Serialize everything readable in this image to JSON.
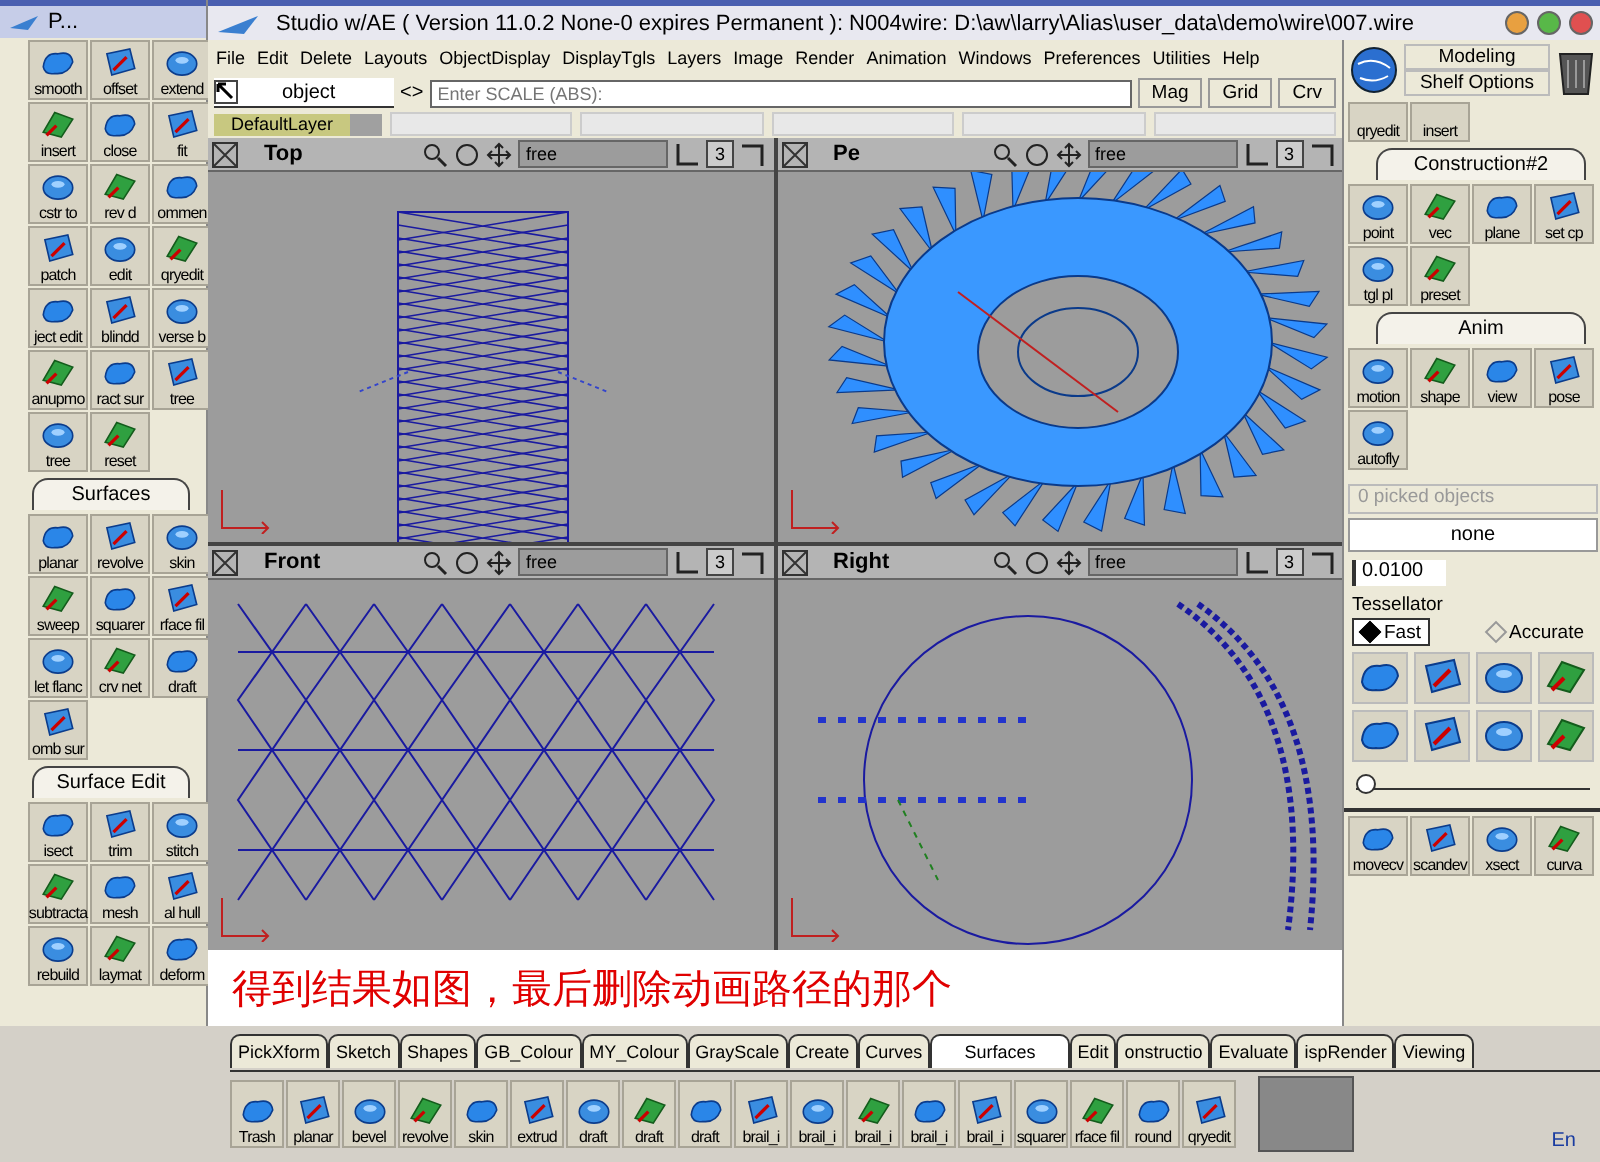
{
  "palette": {
    "title": "P...",
    "sections": [
      {
        "items": [
          "smooth",
          "offset",
          "extend",
          "insert",
          "close",
          "fit",
          "cstr to",
          "rev d",
          "ommen",
          "patch",
          "edit",
          "qryedit",
          "ject edit",
          "blindd",
          "verse b",
          "anupmo",
          "ract sur",
          "tree",
          "tree",
          "reset"
        ]
      },
      {
        "tab": "Surfaces",
        "items": [
          "planar",
          "revolve",
          "skin",
          "sweep",
          "squarer",
          "rface fil",
          "let flanc",
          "crv net",
          "draft",
          "omb sur"
        ]
      },
      {
        "tab": "Surface Edit",
        "items": [
          "isect",
          "trim",
          "stitch",
          "subtracta",
          "mesh",
          "al hull",
          "rebuild",
          "laymat",
          "deform"
        ]
      }
    ]
  },
  "window": {
    "title": "Studio w/AE ( Version 11.0.2 None-0 expires Permanent ): N004wire: D:\\aw\\larry\\Alias\\user_data\\demo\\wire\\007.wire"
  },
  "menu": [
    "File",
    "Edit",
    "Delete",
    "Layouts",
    "ObjectDisplay",
    "DisplayTgls",
    "Layers",
    "Image",
    "Render",
    "Animation",
    "Windows",
    "Preferences",
    "Utilities",
    "Help"
  ],
  "toolbar": {
    "mode": "object",
    "toggle": "<>",
    "scale_field": {
      "placeholder": "Enter SCALE (ABS):"
    },
    "buttons": [
      "Mag",
      "Grid",
      "Crv"
    ]
  },
  "layers": [
    "DefaultLayer"
  ],
  "viewports": [
    {
      "label": "Top",
      "kind": "top",
      "mode": "free",
      "count": "3"
    },
    {
      "label": "Pe",
      "kind": "perspective",
      "mode": "free",
      "count": "3"
    },
    {
      "label": "Front",
      "kind": "front",
      "mode": "free",
      "count": "3"
    },
    {
      "label": "Right",
      "kind": "side",
      "mode": "free",
      "count": "3"
    }
  ],
  "banner": "得到结果如图，最后删除动画路径的那个",
  "right_panel": {
    "header": [
      "Modeling",
      "Shelf Options"
    ],
    "shelf_items": [
      "qryedit",
      "insert"
    ],
    "sections": [
      {
        "tab": "Construction#2",
        "items": [
          "point",
          "vec",
          "plane",
          "set cp",
          "tgl pl",
          "preset"
        ]
      },
      {
        "tab": "Anim",
        "items": [
          "motion",
          "shape",
          "view",
          "pose",
          "autofly"
        ]
      }
    ],
    "picked": "0 picked objects",
    "selection": "none",
    "tolerance": "0.0100",
    "tessellator": {
      "label": "Tessellator",
      "options": [
        {
          "label": "Fast",
          "selected": true
        },
        {
          "label": "Accurate",
          "selected": false
        }
      ],
      "slider": {
        "level": 0
      }
    },
    "shelf_items_bottom": [
      "movecv",
      "scandev",
      "xsect",
      "curva"
    ]
  },
  "shelf_tabs": [
    {
      "label": "PickXform",
      "selected": false
    },
    {
      "label": "Sketch",
      "selected": false
    },
    {
      "label": "Shapes",
      "selected": false
    },
    {
      "label": "GB_Colour",
      "selected": false
    },
    {
      "label": "MY_Colour",
      "selected": false
    },
    {
      "label": "GrayScale",
      "selected": false
    },
    {
      "label": "Create",
      "selected": false
    },
    {
      "label": "Curves",
      "selected": false
    },
    {
      "label": "Surfaces",
      "selected": true
    },
    {
      "label": "Edit",
      "selected": false
    },
    {
      "label": "onstructio",
      "selected": false
    },
    {
      "label": "Evaluate",
      "selected": false
    },
    {
      "label": "ispRender",
      "selected": false
    },
    {
      "label": "Viewing",
      "selected": false
    }
  ],
  "shelf": [
    "Trash",
    "planar",
    "bevel",
    "revolve",
    "skin",
    "extrud",
    "draft",
    "draft",
    "draft",
    "brail_i",
    "brail_i",
    "brail_i",
    "brail_i",
    "brail_i",
    "squarer",
    "rface fil",
    "round",
    "qryedit"
  ],
  "taskbar": {
    "language": "En"
  }
}
